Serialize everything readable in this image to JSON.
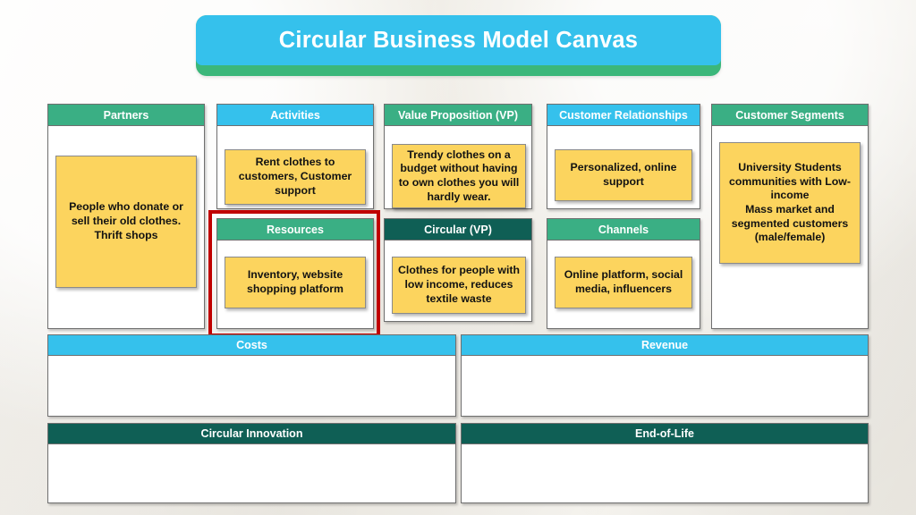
{
  "title": {
    "text": "Circular Business Model Canvas",
    "banner_face_color": "#35c1ec",
    "banner_base_color": "#3bb77a"
  },
  "palette": {
    "green": "#3aaf84",
    "cyan": "#35c1ec",
    "dark_teal": "#0f5f55",
    "note_yellow": "#fcd45e",
    "highlight_red": "#c00000",
    "background": "#f3f1ec"
  },
  "blocks": {
    "partners": {
      "header": "Partners",
      "header_color": "green",
      "note": "People who donate or sell their old clothes.\nThrift shops"
    },
    "activities": {
      "header": "Activities",
      "header_color": "cyan",
      "note": "Rent clothes to customers, Customer support"
    },
    "resources": {
      "header": "Resources",
      "header_color": "green",
      "note": "Inventory, website shopping platform",
      "highlighted": "true"
    },
    "value_proposition": {
      "header": "Value Proposition (VP)",
      "header_color": "green",
      "note": "Trendy clothes on a budget without having to own clothes you will hardly wear."
    },
    "circular_vp": {
      "header": "Circular (VP)",
      "header_color": "dark_teal",
      "note": "Clothes for people with low income, reduces textile waste"
    },
    "customer_relationships": {
      "header": "Customer Relationships",
      "header_color": "cyan",
      "note": "Personalized, online support"
    },
    "channels": {
      "header": "Channels",
      "header_color": "green",
      "note": "Online platform, social media, influencers"
    },
    "customer_segments": {
      "header": "Customer Segments",
      "header_color": "green",
      "note": "University Students communities with Low-income\nMass market and segmented customers (male/female)"
    },
    "costs": {
      "header": "Costs",
      "header_color": "cyan",
      "note": ""
    },
    "revenue": {
      "header": "Revenue",
      "header_color": "cyan",
      "note": ""
    },
    "circular_innovation": {
      "header": "Circular Innovation",
      "header_color": "dark_teal",
      "note": ""
    },
    "end_of_life": {
      "header": "End-of-Life",
      "header_color": "dark_teal",
      "note": ""
    }
  }
}
